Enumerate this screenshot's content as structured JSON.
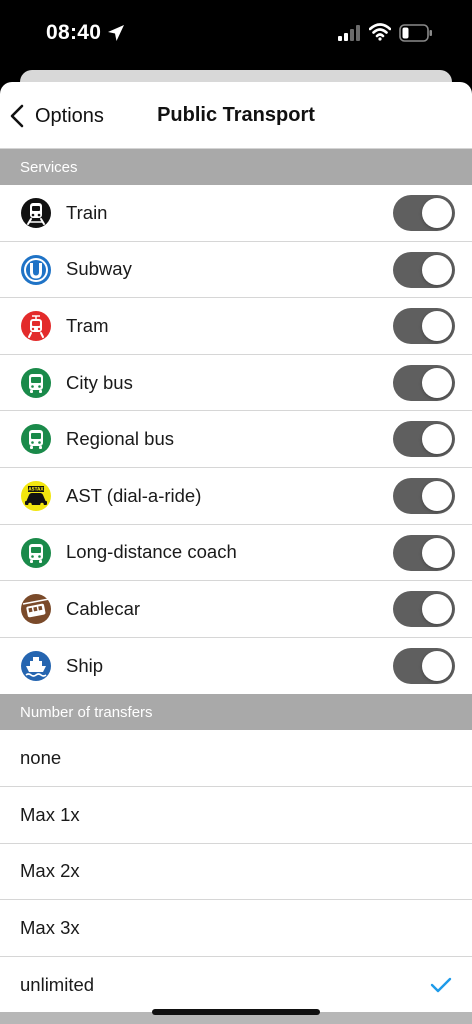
{
  "status": {
    "time": "08:40"
  },
  "nav": {
    "back_label": "Options",
    "title": "Public Transport"
  },
  "services": {
    "header": "Services",
    "items": [
      {
        "label": "Train",
        "icon": "train-icon",
        "enabled": true
      },
      {
        "label": "Subway",
        "icon": "subway-icon",
        "enabled": true
      },
      {
        "label": "Tram",
        "icon": "tram-icon",
        "enabled": true
      },
      {
        "label": "City bus",
        "icon": "city-bus-icon",
        "enabled": true
      },
      {
        "label": "Regional bus",
        "icon": "regional-bus-icon",
        "enabled": true
      },
      {
        "label": "AST (dial-a-ride)",
        "icon": "ast-taxi-icon",
        "enabled": true
      },
      {
        "label": "Long-distance coach",
        "icon": "coach-icon",
        "enabled": true
      },
      {
        "label": "Cablecar",
        "icon": "cablecar-icon",
        "enabled": true
      },
      {
        "label": "Ship",
        "icon": "ship-icon",
        "enabled": true
      }
    ]
  },
  "transfers": {
    "header": "Number of transfers",
    "options": [
      {
        "label": "none",
        "selected": false
      },
      {
        "label": "Max 1x",
        "selected": false
      },
      {
        "label": "Max 2x",
        "selected": false
      },
      {
        "label": "Max 3x",
        "selected": false
      },
      {
        "label": "unlimited",
        "selected": true
      }
    ]
  },
  "icons": {
    "ast_badge_text": "ASTAX"
  },
  "colors": {
    "section_header": "#a9a9a9",
    "toggle_track": "#5f5f5f",
    "check": "#1e9be9",
    "train": "#111111",
    "subway": "#1f73c6",
    "tram": "#e32b2b",
    "bus": "#1a8a4a",
    "ast": "#f2e60f",
    "cablecar": "#7a4a2a",
    "ship": "#2565b0"
  }
}
